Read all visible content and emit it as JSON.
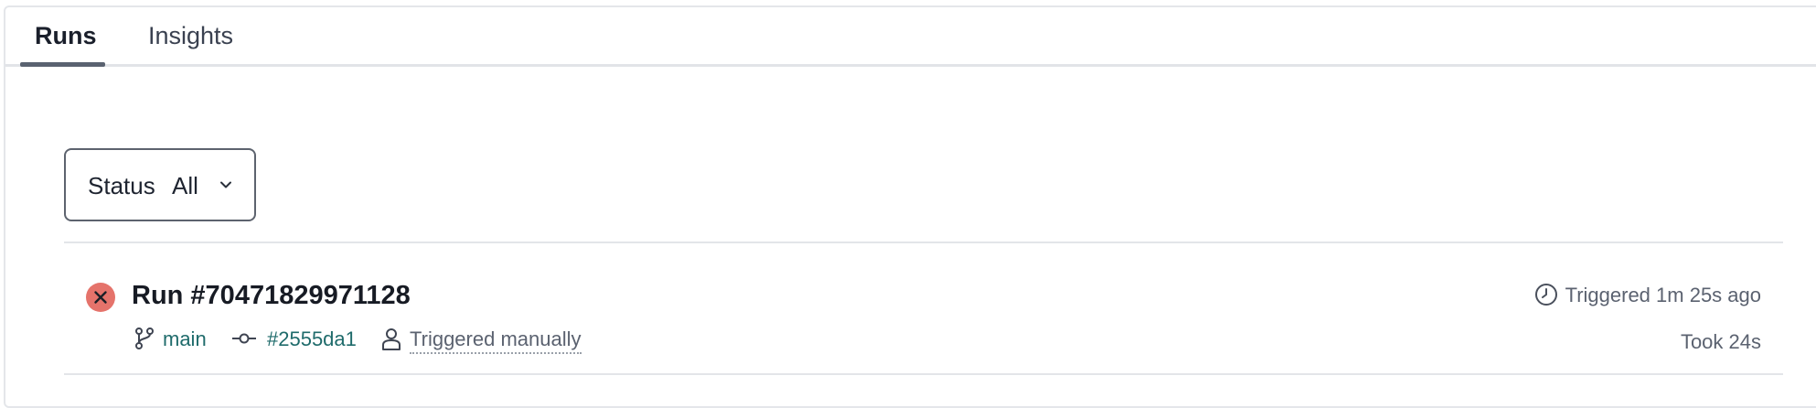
{
  "tabs": {
    "runs": "Runs",
    "insights": "Insights"
  },
  "filter": {
    "label": "Status",
    "value": "All"
  },
  "run": {
    "title": "Run #70471829971128",
    "status": "failed",
    "status_color": "#e5736b",
    "branch": "main",
    "commit": "#2555da1",
    "trigger": "Triggered manually",
    "triggered_ago": "Triggered 1m 25s ago",
    "duration": "Took 24s"
  },
  "icons": {
    "status": "x-circle-icon",
    "branch": "git-branch-icon",
    "commit": "git-commit-icon",
    "user": "user-icon",
    "clock": "clock-icon",
    "chevron": "chevron-down-icon"
  },
  "colors": {
    "link": "#1f6b6b",
    "muted": "#5b6270",
    "fail": "#e5736b"
  }
}
